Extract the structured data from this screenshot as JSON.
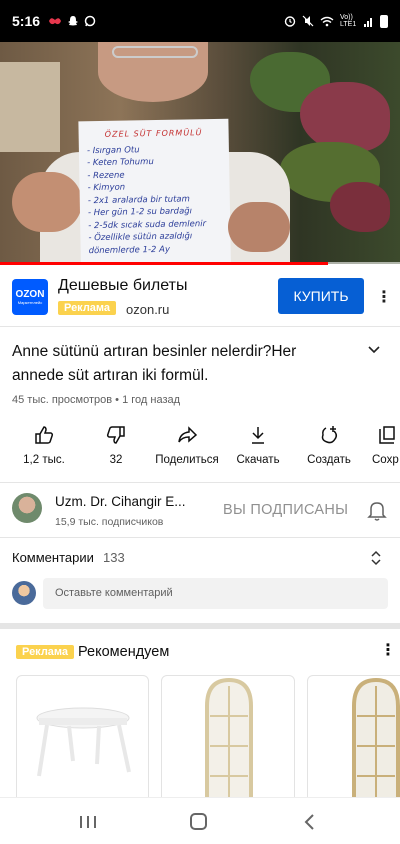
{
  "status_bar": {
    "time": "5:16",
    "left_icons": [
      "notification-icon",
      "snapchat-icon",
      "whatsapp-icon"
    ],
    "right_icons": [
      "alarm-icon",
      "mute-icon",
      "wifi-icon",
      "signal-icon",
      "battery-icon"
    ],
    "network_label": "Vo)) LTE1"
  },
  "video": {
    "progress_fraction": 0.82,
    "paper_lines": [
      "ÖZEL SÜT FORMÜLÜ",
      "- Isırgan Otu",
      "- Keten Tohumu",
      "- Rezene",
      "- Kimyon",
      "- 2x1 aralarda bir tutam",
      "- Her gün 1-2 su bardağı",
      "- 2-5dk sıcak suda demlenir",
      "- Özellikle sütün azaldığı",
      "  dönemlerde 1-2 Ay"
    ]
  },
  "ad": {
    "logo_text": "OZON",
    "logo_subtext": "Маркетплейс",
    "title": "Дешевые билеты",
    "badge": "Реклама",
    "domain": "ozon.ru",
    "cta": "КУПИТЬ"
  },
  "video_info": {
    "title": "Anne sütünü artıran besinler nelerdir?Her annede süt artıran iki formül.",
    "views": "45 тыс. просмотров",
    "separator": "•",
    "age": "1 год назад"
  },
  "actions": [
    {
      "label": "1,2 тыс.",
      "icon": "like-icon"
    },
    {
      "label": "32",
      "icon": "dislike-icon"
    },
    {
      "label": "Поделиться",
      "icon": "share-icon"
    },
    {
      "label": "Скачать",
      "icon": "download-icon"
    },
    {
      "label": "Создать",
      "icon": "create-icon"
    },
    {
      "label": "Сохр",
      "icon": "save-icon"
    }
  ],
  "channel": {
    "name": "Uzm. Dr. Cihangir E...",
    "subscribers": "15,9 тыс. подписчиков",
    "subscribe_state": "ВЫ ПОДПИСАНЫ"
  },
  "comments": {
    "label": "Комментарии",
    "count": "133",
    "placeholder": "Оставьте комментарий"
  },
  "recommended": {
    "badge": "Реклама",
    "title": "Рекомендуем"
  },
  "colors": {
    "primary_blue": "#065fd4",
    "ozon_blue": "#005bff",
    "ad_yellow": "#fbd24e",
    "progress_red": "#ff0000"
  }
}
